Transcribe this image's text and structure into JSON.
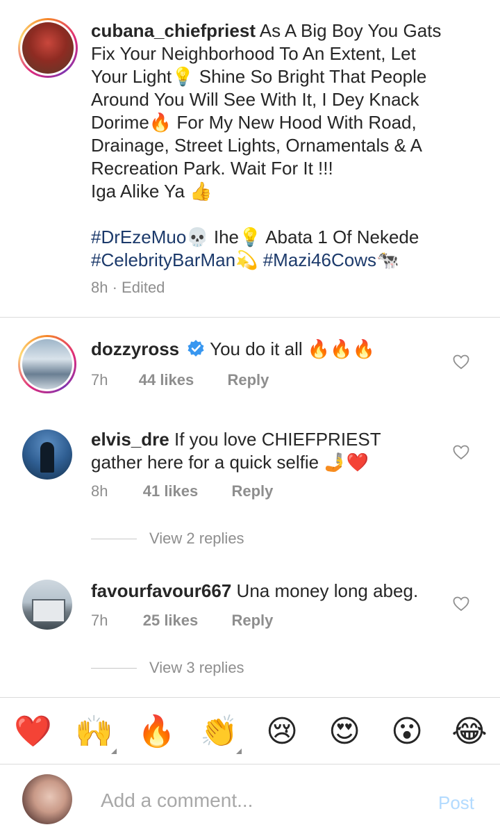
{
  "caption": {
    "username": "cubana_chiefpriest",
    "lines": [
      " As A Big Boy You Gats",
      "Fix Your Neighborhood To An Extent, Let",
      "Your Light💡 Shine So Bright That People",
      "Around You Will See With It, I Dey Knack",
      "Dorime🔥 For My New Hood With Road,",
      "Drainage, Street Lights, Ornamentals & A",
      "Recreation Park. Wait For It !!!",
      "Iga Alike Ya 👍"
    ],
    "tags_line1_a": "#DrEzeMuo",
    "tags_line1_b": "💀 Ihe💡 Abata 1 Of Nekede",
    "tags_line2_a": "#CelebrityBarMan",
    "tags_line2_b": "💫 ",
    "tags_line2_c": "#Mazi46Cows",
    "tags_line2_d": "🐄",
    "time": "8h",
    "edited": " · Edited"
  },
  "comments": [
    {
      "username": "dozzyross",
      "verified": true,
      "text": " You do it all 🔥🔥🔥",
      "time": "7h",
      "likes": "44 likes",
      "reply": "Reply"
    },
    {
      "username": "elvis_dre",
      "text_line1": " If you love CHIEFPRIEST",
      "text_line2": "gather here for a quick selfie 🤳❤️",
      "time": "8h",
      "likes": "41 likes",
      "reply": "Reply",
      "view_replies": "View 2 replies"
    },
    {
      "username": "favourfavour667",
      "text": " Una money long abeg.",
      "time": "7h",
      "likes": "25 likes",
      "reply": "Reply",
      "view_replies": "View 3 replies"
    }
  ],
  "emoji_bar": [
    "❤️",
    "🙌",
    "🔥",
    "👏",
    "😢",
    "😍",
    "😮",
    "😂"
  ],
  "composer": {
    "placeholder": "Add a comment...",
    "post_label": "Post"
  },
  "colors": {
    "hashtag": "#1c3a6b",
    "muted": "#8e8e8e",
    "post_disabled": "#b3dbff",
    "verified": "#3897f0"
  }
}
